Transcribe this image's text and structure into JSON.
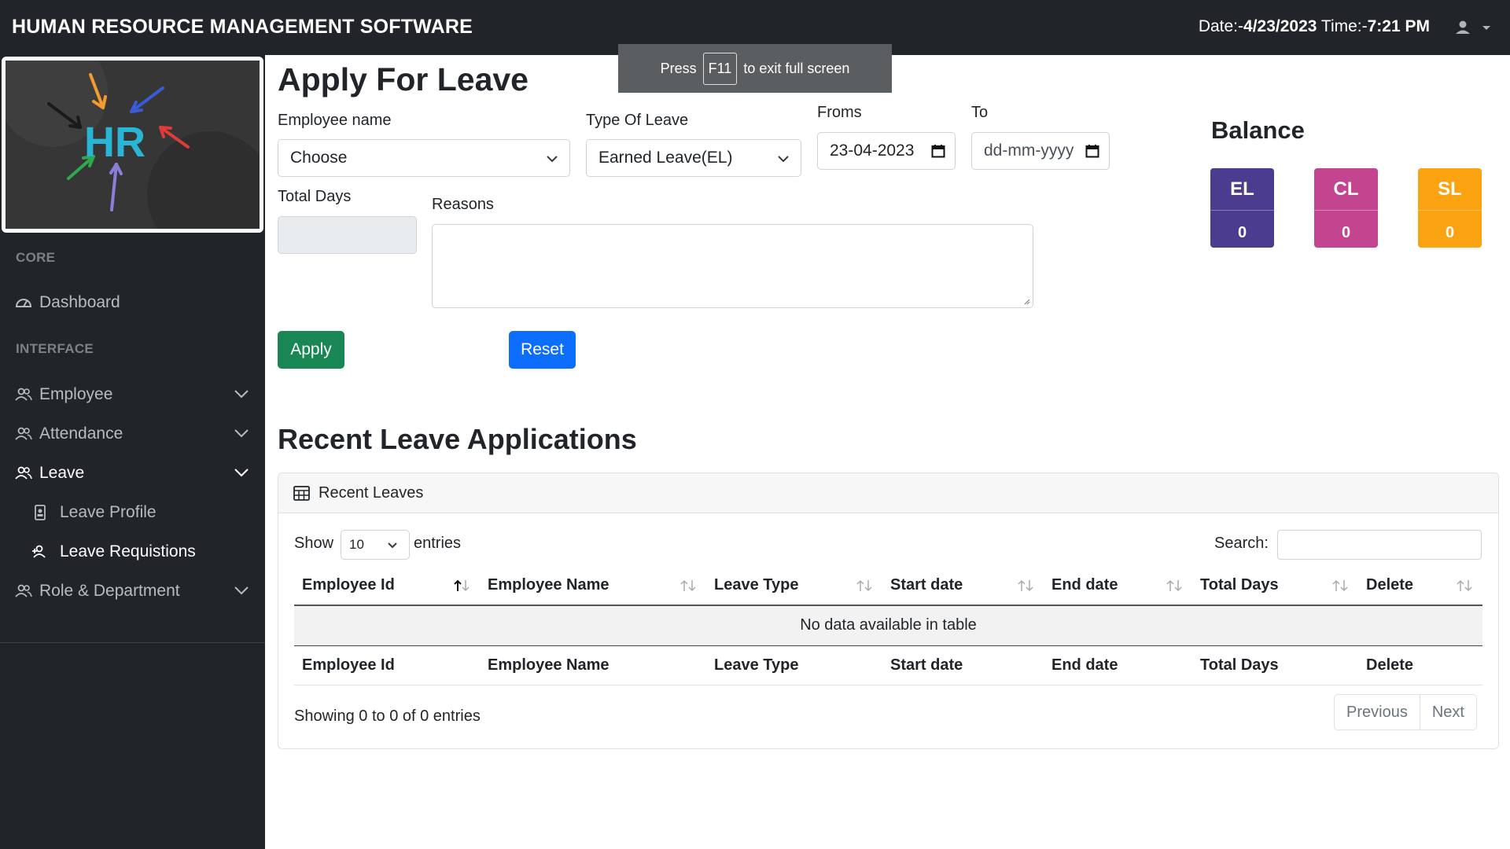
{
  "header": {
    "brand": "HUMAN RESOURCE MANAGEMENT SOFTWARE",
    "date_label": "Date:-",
    "date_value": "4/23/2023",
    "time_label": " Time:-",
    "time_value": "7:21 PM",
    "user_icon": "user-icon"
  },
  "toast": {
    "prefix": "Press",
    "key": "F11",
    "suffix": "to exit full screen"
  },
  "sidebar": {
    "logo_text": "HR",
    "core_heading": "CORE",
    "interface_heading": "INTERFACE",
    "items": [
      {
        "label": "Dashboard",
        "icon": "dashboard-icon"
      },
      {
        "label": "Employee",
        "icon": "users-icon"
      },
      {
        "label": "Attendance",
        "icon": "users-icon"
      },
      {
        "label": "Leave",
        "icon": "users-icon"
      },
      {
        "label": "Leave Profile",
        "icon": "badge-icon"
      },
      {
        "label": "Leave Requistions",
        "icon": "user-plus-icon"
      },
      {
        "label": "Role & Department",
        "icon": "users-icon"
      }
    ]
  },
  "form": {
    "title": "Apply For Leave",
    "employee_label": "Employee name",
    "employee_value": "Choose",
    "leave_type_label": "Type Of Leave",
    "leave_type_value": "Earned Leave(EL)",
    "from_label": "Froms",
    "from_value": "23-04-2023",
    "to_label": "To",
    "to_value": "dd-mm-yyyy",
    "total_days_label": "Total Days",
    "total_days_value": "",
    "reasons_label": "Reasons",
    "reasons_value": "",
    "apply_label": "Apply",
    "reset_label": "Reset"
  },
  "balance": {
    "title": "Balance",
    "cards": [
      {
        "label": "EL",
        "value": "0",
        "color": "#4b3c8f"
      },
      {
        "label": "CL",
        "value": "0",
        "color": "#c3458f"
      },
      {
        "label": "SL",
        "value": "0",
        "color": "#fca311"
      }
    ]
  },
  "recent": {
    "title": "Recent Leave Applications",
    "card_title": "Recent Leaves",
    "show_label": "Show",
    "entries_value": "10",
    "entries_label": "entries",
    "search_label": "Search:",
    "columns": [
      "Employee Id",
      "Employee Name",
      "Leave Type",
      "Start date",
      "End date",
      "Total Days",
      "Delete"
    ],
    "empty_message": "No data available in table",
    "info": "Showing 0 to 0 of 0 entries",
    "prev_label": "Previous",
    "next_label": "Next"
  }
}
